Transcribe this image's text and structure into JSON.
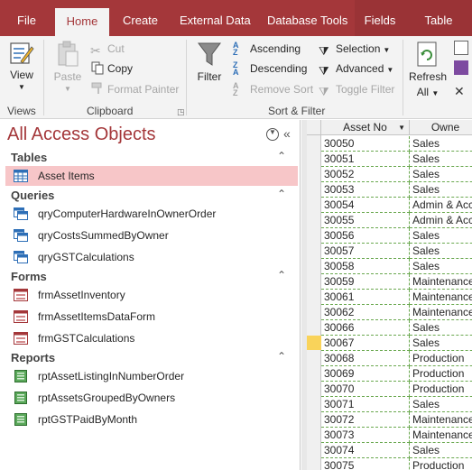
{
  "tabs": [
    {
      "label": "File"
    },
    {
      "label": "Home"
    },
    {
      "label": "Create"
    },
    {
      "label": "External Data"
    },
    {
      "label": "Database Tools"
    },
    {
      "label": "Fields"
    },
    {
      "label": "Table"
    }
  ],
  "ribbon": {
    "views": {
      "view_label": "View",
      "group_label": "Views"
    },
    "clipboard": {
      "paste_label": "Paste",
      "cut_label": "Cut",
      "copy_label": "Copy",
      "format_painter_label": "Format Painter",
      "group_label": "Clipboard"
    },
    "sort_filter": {
      "filter_label": "Filter",
      "ascending_label": "Ascending",
      "descending_label": "Descending",
      "remove_sort_label": "Remove Sort",
      "selection_label": "Selection",
      "advanced_label": "Advanced",
      "toggle_filter_label": "Toggle Filter",
      "group_label": "Sort & Filter"
    },
    "records": {
      "refresh_label": "Refresh",
      "refresh_all_label": "All"
    }
  },
  "nav": {
    "title": "All Access Objects",
    "sections": [
      {
        "label": "Tables",
        "items": [
          {
            "label": "Asset Items"
          }
        ]
      },
      {
        "label": "Queries",
        "items": [
          {
            "label": "qryComputerHardwareInOwnerOrder"
          },
          {
            "label": "qryCostsSummedByOwner"
          },
          {
            "label": "qryGSTCalculations"
          }
        ]
      },
      {
        "label": "Forms",
        "items": [
          {
            "label": "frmAssetInventory"
          },
          {
            "label": "frmAssetItemsDataForm"
          },
          {
            "label": "frmGSTCalculations"
          }
        ]
      },
      {
        "label": "Reports",
        "items": [
          {
            "label": "rptAssetListingInNumberOrder"
          },
          {
            "label": "rptAssetsGroupedByOwners"
          },
          {
            "label": "rptGSTPaidByMonth"
          }
        ]
      }
    ]
  },
  "sheet": {
    "columns": [
      "Asset No",
      "Owne"
    ],
    "rows": [
      [
        "30050",
        "Sales"
      ],
      [
        "30051",
        "Sales"
      ],
      [
        "30052",
        "Sales"
      ],
      [
        "30053",
        "Sales"
      ],
      [
        "30054",
        "Admin & Acc"
      ],
      [
        "30055",
        "Admin & Acc"
      ],
      [
        "30056",
        "Sales"
      ],
      [
        "30057",
        "Sales"
      ],
      [
        "30058",
        "Sales"
      ],
      [
        "30059",
        "Maintenance"
      ],
      [
        "30061",
        "Maintenance"
      ],
      [
        "30062",
        "Maintenance"
      ],
      [
        "30066",
        "Sales"
      ],
      [
        "30067",
        "Sales"
      ],
      [
        "30068",
        "Production"
      ],
      [
        "30069",
        "Production"
      ],
      [
        "30070",
        "Production"
      ],
      [
        "30071",
        "Sales"
      ],
      [
        "30072",
        "Maintenance"
      ],
      [
        "30073",
        "Maintenance"
      ],
      [
        "30074",
        "Sales"
      ],
      [
        "30075",
        "Production"
      ]
    ],
    "selected_row": 13
  },
  "colors": {
    "accent": "#a4373a",
    "selected_item": "#f7c6c8",
    "record_marker": "#f9d35a"
  }
}
